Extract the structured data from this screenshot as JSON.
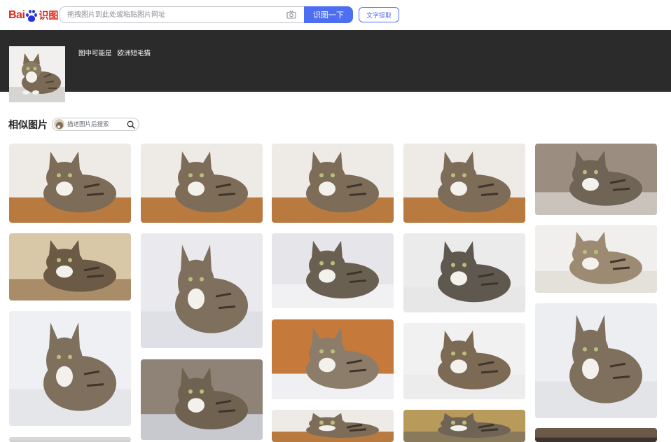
{
  "header": {
    "logo_text": "Bai",
    "logo_suffix": "识图",
    "search_placeholder": "拖拽图片到此处或粘贴图片网址",
    "search_button": "识图一下",
    "text_extract_button": "文字提取"
  },
  "result": {
    "prefix": "图中可能是",
    "guess": "欧洲短毛猫"
  },
  "similar": {
    "title": "相似图片",
    "search_placeholder": "描述图片后搜索"
  },
  "colors": {
    "brand_blue": "#4e6ef2",
    "brand_red": "#e1251b",
    "band": "#2b2b2b"
  },
  "icons": [
    "camera-icon",
    "search-icon"
  ]
}
